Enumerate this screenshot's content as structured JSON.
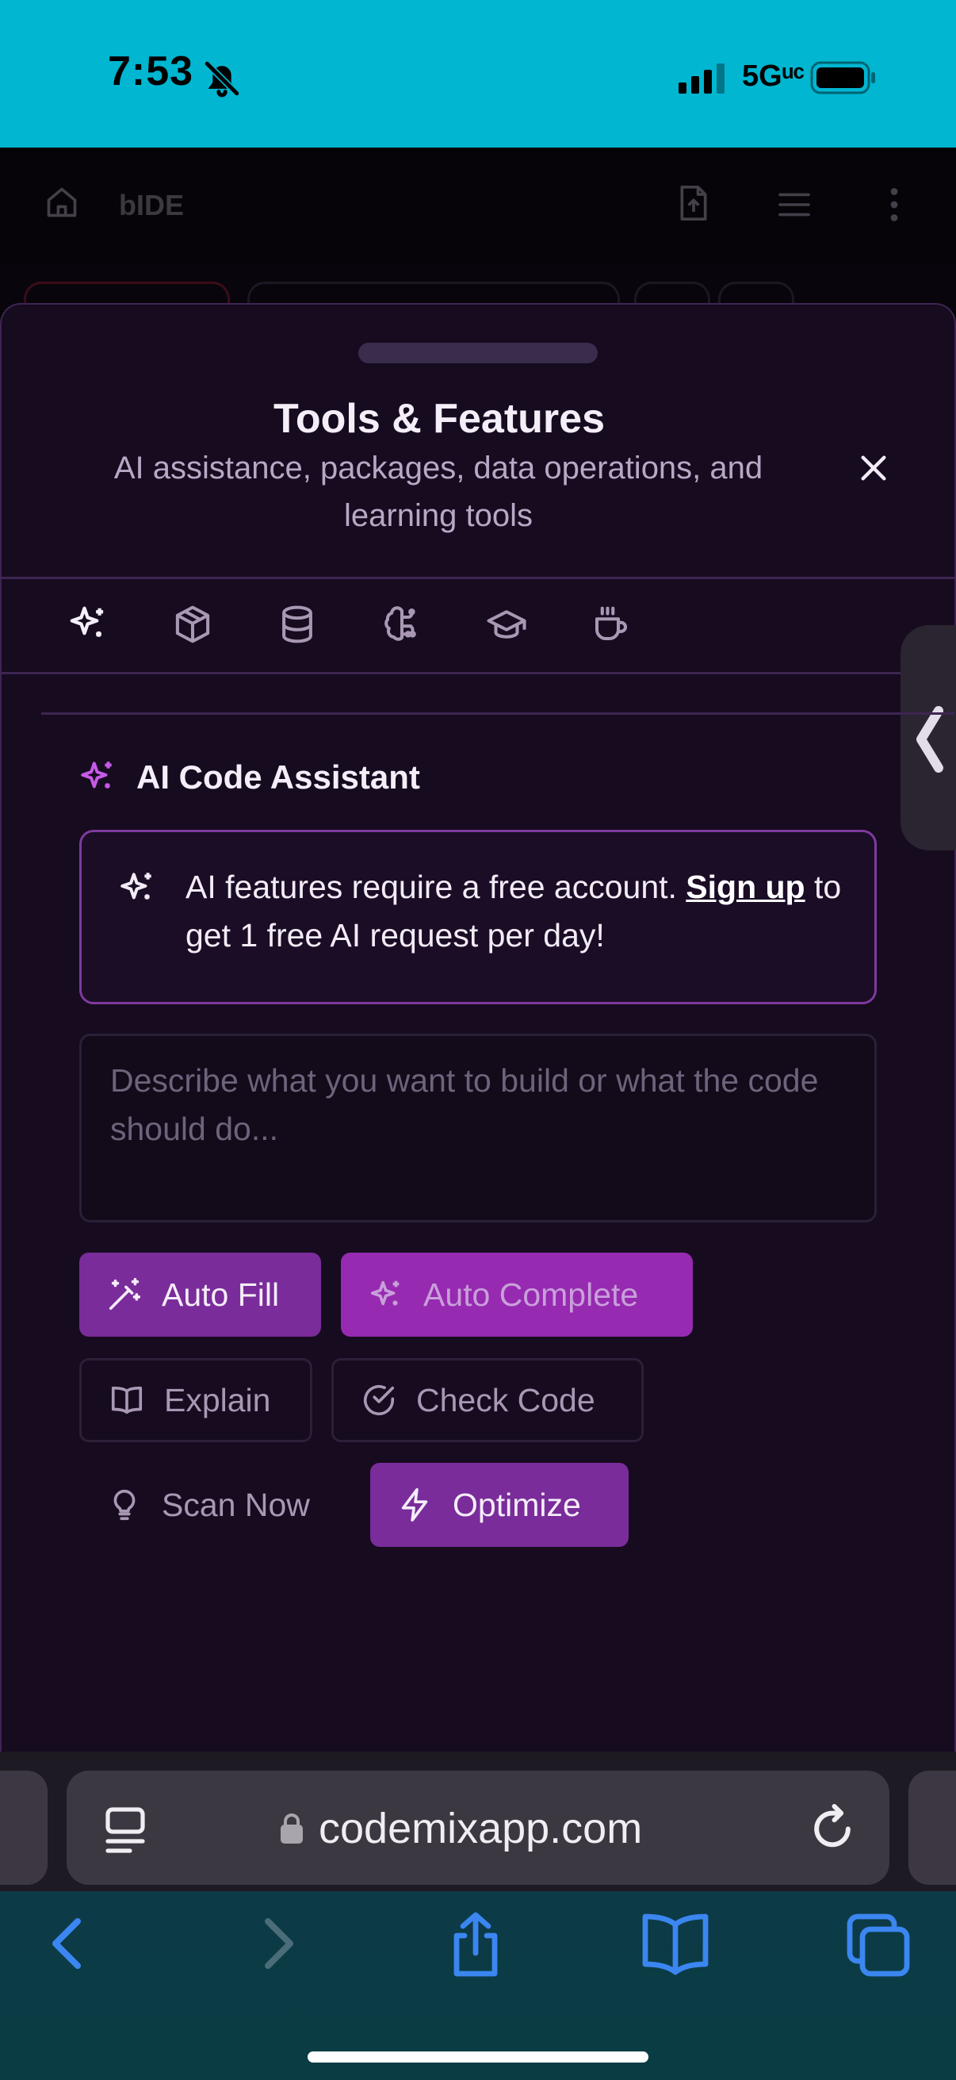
{
  "status_bar": {
    "time": "7:53",
    "network": "5Gᵘᶜ"
  },
  "app_header": {
    "title": "bIDE"
  },
  "modal": {
    "title": "Tools & Features",
    "subtitle": "AI assistance, packages, data operations, and learning tools",
    "tabs": [
      "sparkles-icon",
      "package-icon",
      "database-icon",
      "brain-icon",
      "graduation-cap-icon",
      "coffee-icon"
    ]
  },
  "ai_section": {
    "title": "AI Code Assistant",
    "alert_prefix": "AI features require a free account. ",
    "alert_link": "Sign up",
    "alert_suffix": " to get 1 free AI request per day!",
    "prompt_placeholder": "Describe what you want to build or what the code should do...",
    "buttons": {
      "auto_fill": "Auto Fill",
      "auto_complete": "Auto Complete",
      "explain": "Explain",
      "check_code": "Check Code",
      "scan_now": "Scan Now",
      "optimize": "Optimize"
    }
  },
  "browser": {
    "url": "codemixapp.com"
  },
  "colors": {
    "accent": "#7a2c9a",
    "status_bar": "#00b6d1",
    "modal_bg": "#160b1f"
  }
}
